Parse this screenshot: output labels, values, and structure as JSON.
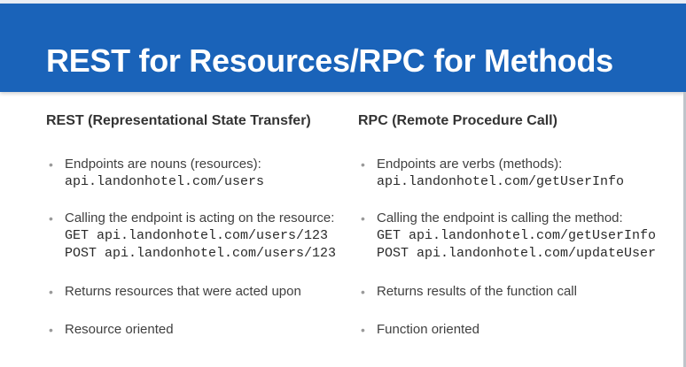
{
  "slide": {
    "title": "REST for Resources/RPC for Methods",
    "brand_color": "#1a63b9",
    "bullet_glyph": "•"
  },
  "rest": {
    "heading": "REST (Representational State Transfer)",
    "bullets": [
      {
        "text": "Endpoints are nouns (resources):",
        "code": [
          "api.landonhotel.com/users"
        ]
      },
      {
        "text": "Calling the endpoint is acting on the resource:",
        "code": [
          "GET api.landonhotel.com/users/123",
          "POST api.landonhotel.com/users/123"
        ]
      },
      {
        "text": "Returns resources that were acted upon",
        "code": []
      },
      {
        "text": "Resource oriented",
        "code": []
      }
    ]
  },
  "rpc": {
    "heading": "RPC (Remote Procedure Call)",
    "bullets": [
      {
        "text": "Endpoints are verbs (methods):",
        "code": [
          "api.landonhotel.com/getUserInfo"
        ]
      },
      {
        "text": "Calling the endpoint is calling the method:",
        "code": [
          "GET api.landonhotel.com/getUserInfo",
          "POST api.landonhotel.com/updateUser"
        ]
      },
      {
        "text": "Returns results of the function call",
        "code": []
      },
      {
        "text": "Function oriented",
        "code": []
      }
    ]
  }
}
